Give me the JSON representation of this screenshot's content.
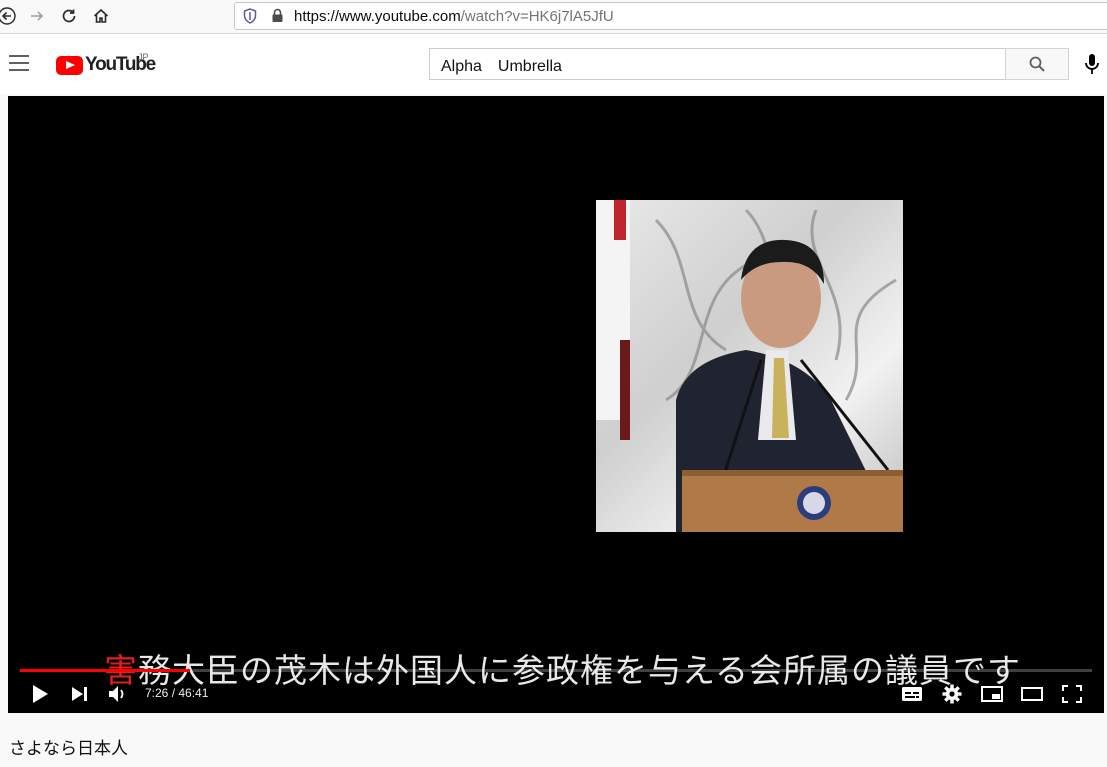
{
  "browser": {
    "url_host": "https://www.youtube.com",
    "url_path": "/watch?v=HK6j7lA5JfU"
  },
  "header": {
    "logo_text": "YouTube",
    "region": "JP",
    "search_value": "Alpha　Umbrella"
  },
  "player": {
    "subtitle_accent": "害",
    "subtitle_rest": "務大臣の茂木は外国人に参政権を与える会所属の議員です",
    "current_time": "7:26",
    "duration": "46:41",
    "progress_fraction": 0.159
  },
  "video": {
    "title": "さよなら日本人"
  },
  "colors": {
    "brand": "#ff0000",
    "player_bg": "#000000"
  }
}
